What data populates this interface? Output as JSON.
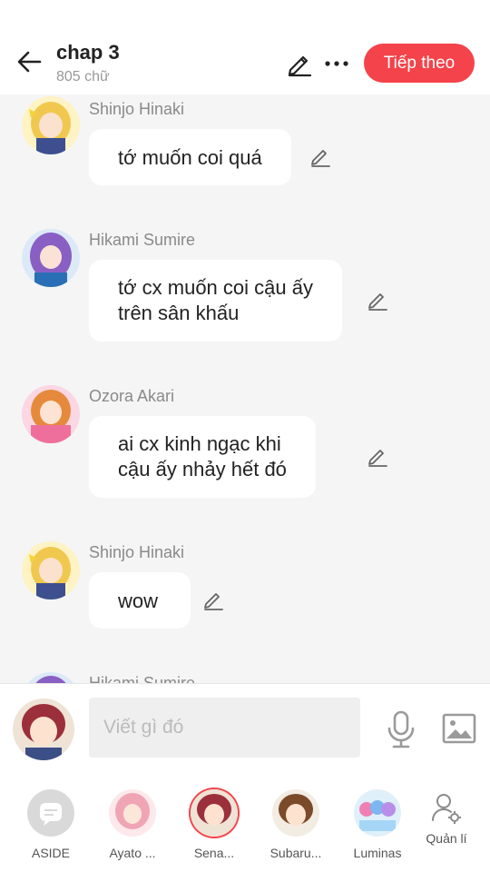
{
  "header": {
    "chapter_title": "chap 3",
    "word_count": "805 chữ",
    "next_label": "Tiếp theo"
  },
  "messages": [
    {
      "sender": "Shinjo Hinaki",
      "lines": [
        "tớ muốn coi quá"
      ]
    },
    {
      "sender": "Hikami Sumire",
      "lines": [
        "tớ cx muốn coi cậu ấy",
        "trên sân khấu"
      ]
    },
    {
      "sender": "Ozora Akari",
      "lines": [
        "ai cx kinh ngạc khi",
        "cậu ấy nhảy hết đó"
      ]
    },
    {
      "sender": "Shinjo Hinaki",
      "lines": [
        "wow"
      ]
    },
    {
      "sender": "Hikami Sumire",
      "lines": []
    }
  ],
  "composer": {
    "placeholder": "Viết gì đó"
  },
  "characters": [
    {
      "name": "ASIDE"
    },
    {
      "name": "Ayato ..."
    },
    {
      "name": "Sena..."
    },
    {
      "name": "Subaru..."
    },
    {
      "name": "Luminas"
    },
    {
      "name": "Quản lí"
    }
  ],
  "colors": {
    "accent": "#f4434a",
    "background": "#f5f5f5",
    "bubble": "#ffffff",
    "muted_text": "#8a8a8a"
  },
  "icons": [
    "back-arrow-icon",
    "pencil-icon",
    "more-dots-icon",
    "microphone-icon",
    "image-icon",
    "chat-bubble-icon",
    "user-settings-icon"
  ]
}
